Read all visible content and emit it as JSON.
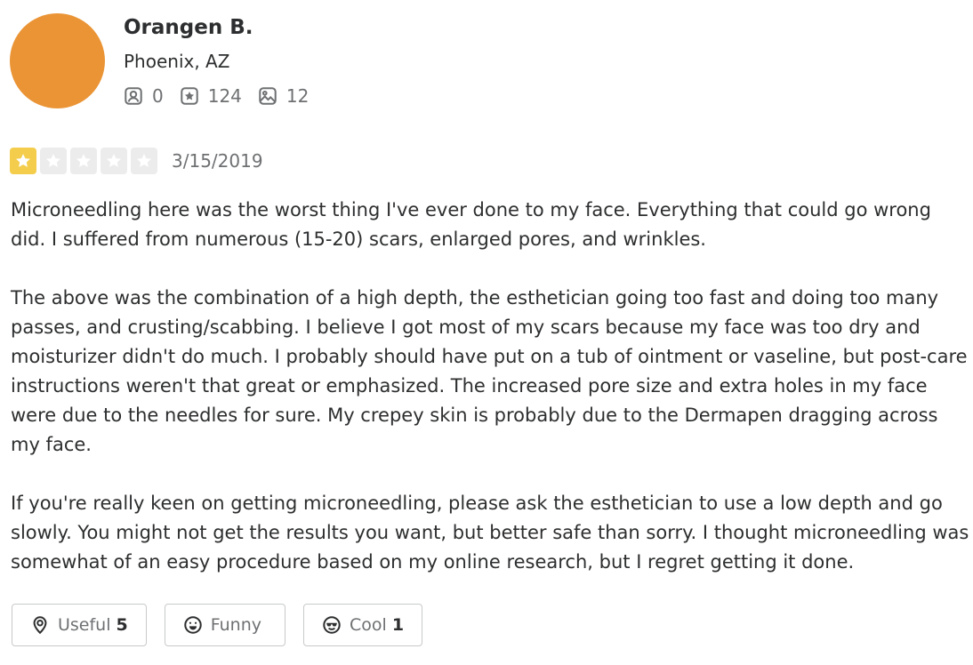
{
  "user": {
    "name": "Orangen B.",
    "location": "Phoenix, AZ",
    "avatar_color": "#ea9435",
    "stats": {
      "friends": "0",
      "reviews": "124",
      "photos": "12"
    }
  },
  "review": {
    "rating": 1,
    "max_rating": 5,
    "date": "3/15/2019",
    "paragraphs": [
      "Microneedling here was the worst thing I've ever done to my face.  Everything that could go wrong did.  I suffered from numerous (15-20) scars, enlarged pores, and wrinkles.",
      "The above was the combination of a high depth, the esthetician going too fast and doing too many passes, and crusting/scabbing.  I believe I got most of my scars because my face was too dry and moisturizer didn't do much.  I probably should have put on a tub of ointment or vaseline, but post-care instructions weren't that great or emphasized.  The increased pore size and extra holes in my face were due to the needles for sure.  My crepey skin is probably due to the Dermapen dragging across my face.",
      "If you're really keen on getting microneedling, please ask the esthetician to use a low depth and go slowly.  You might not get the results you want, but better safe than sorry.  I thought microneedling was somewhat of an easy procedure based on my online research, but I regret getting it done."
    ]
  },
  "reactions": {
    "useful": {
      "label": "Useful",
      "count": "5",
      "icon": "lightbulb-icon"
    },
    "funny": {
      "label": "Funny",
      "count": "",
      "icon": "smile-icon"
    },
    "cool": {
      "label": "Cool",
      "count": "1",
      "icon": "sunglasses-icon"
    }
  },
  "colors": {
    "star_active": "#f3cd4b",
    "star_inactive": "#ececec",
    "text": "#2d2e2f",
    "muted": "#6e7072"
  }
}
